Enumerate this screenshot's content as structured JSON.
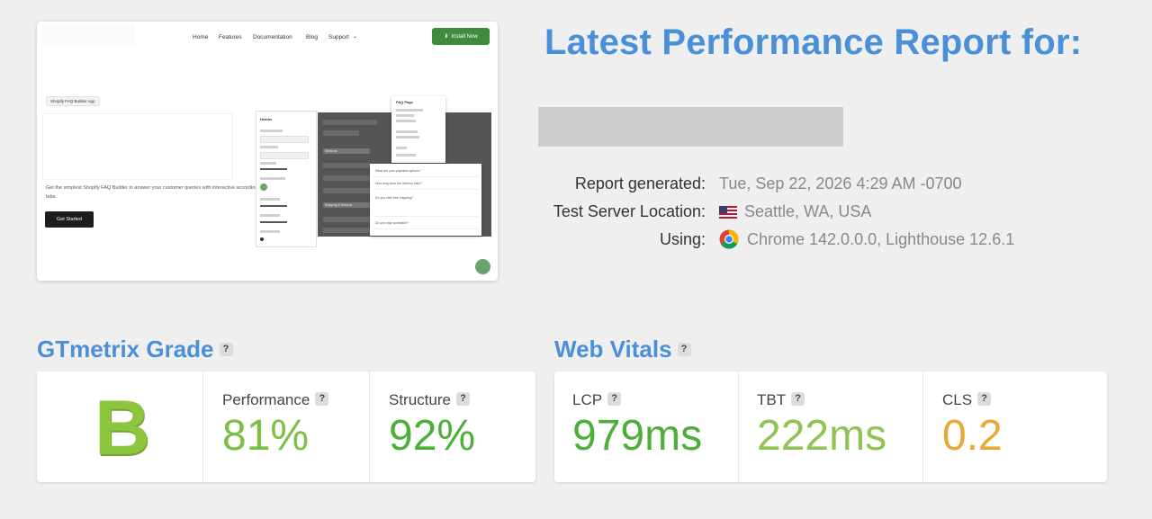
{
  "thumbnail": {
    "nav": [
      "Home",
      "Features",
      "Documentation",
      "Blog",
      "Support"
    ],
    "install_label": "Install Now",
    "badge_label": "Shopify FAQ Builder App",
    "description": "Get the simplest Shopify FAQ Builder to answer your customer queries with interactive accordion tabs.",
    "cta_label": "Get Started",
    "app_left_title": "Header",
    "popup_title": "FAQ Page",
    "faq_questions": [
      "What are your payment options?",
      "How long does the delivery take?",
      "Do you offer free shipping?",
      "Do you ship worldwide?"
    ],
    "sidebar_items": [
      "Sections",
      "Shipping & Returns"
    ]
  },
  "report": {
    "title": "Latest Performance Report for:",
    "generated_label": "Report generated:",
    "generated_value": "Tue, Sep 22, 2026 4:29 AM -0700",
    "location_label": "Test Server Location:",
    "location_value": "Seattle, WA, USA",
    "using_label": "Using:",
    "using_value": "Chrome 142.0.0.0, Lighthouse 12.6.1"
  },
  "grade_section": {
    "title": "GTmetrix Grade",
    "help": "?",
    "grade": "B",
    "performance_label": "Performance",
    "performance_value": "81%",
    "structure_label": "Structure",
    "structure_value": "92%"
  },
  "vitals_section": {
    "title": "Web Vitals",
    "help": "?",
    "lcp_label": "LCP",
    "lcp_value": "979ms",
    "tbt_label": "TBT",
    "tbt_value": "222ms",
    "cls_label": "CLS",
    "cls_value": "0.2"
  },
  "colors": {
    "accent": "#4a90d9",
    "good": "#4caf3a",
    "ok": "#8fc352",
    "warn": "#e8a838"
  }
}
